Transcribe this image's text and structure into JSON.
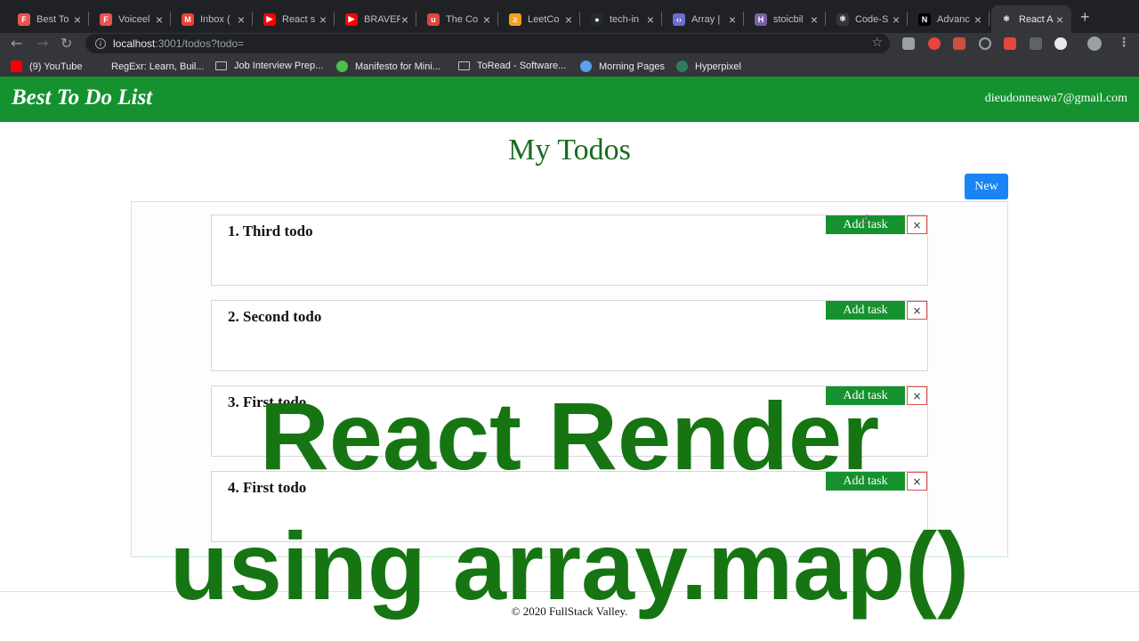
{
  "browser": {
    "tabs": [
      {
        "label": "Best To",
        "color": "#e8554e",
        "glyph": "F"
      },
      {
        "label": "Voiceel",
        "color": "#e8554e",
        "glyph": "F"
      },
      {
        "label": "Inbox (",
        "color": "#ea4335",
        "glyph": "M"
      },
      {
        "label": "React s",
        "color": "#ff0000",
        "glyph": "▶"
      },
      {
        "label": "BRAVEF",
        "color": "#ff0000",
        "glyph": "▶"
      },
      {
        "label": "The Co",
        "color": "#e0443f",
        "glyph": "u"
      },
      {
        "label": "LeetCo",
        "color": "#f89f1b",
        "glyph": "≥"
      },
      {
        "label": "tech-in",
        "color": "#24292e",
        "glyph": "●"
      },
      {
        "label": "Array |",
        "color": "#6e6bd4",
        "glyph": "‹›"
      },
      {
        "label": "stoicbil",
        "color": "#7b5ea7",
        "glyph": "H"
      },
      {
        "label": "Code-S",
        "color": "#35363a",
        "glyph": "⚛"
      },
      {
        "label": "Advanc",
        "color": "#000000",
        "glyph": "N"
      },
      {
        "label": "React A",
        "color": "#35363a",
        "glyph": "⚛",
        "active": true
      }
    ],
    "new_tab": "+",
    "url_host": "localhost",
    "url_rest": ":3001/todos?todo=",
    "bookmarks": [
      {
        "label": "(9) YouTube",
        "icon": "youtube-icon"
      },
      {
        "label": "RegExr: Learn, Buil...",
        "icon": "regexr-icon"
      },
      {
        "label": "Job Interview Prep...",
        "icon": "folder-icon"
      },
      {
        "label": "Manifesto for Mini...",
        "icon": "circle-icon"
      },
      {
        "label": "ToRead - Software...",
        "icon": "folder-icon"
      },
      {
        "label": "Morning Pages",
        "icon": "globe-icon"
      },
      {
        "label": "Hyperpixel",
        "icon": "h-icon"
      }
    ]
  },
  "app": {
    "brand": "Best To Do List",
    "user_email": "dieudonneawa7@gmail.com",
    "page_title": "My Todos",
    "new_button": "New",
    "add_task_label": "Add task",
    "delete_label": "×",
    "todos": [
      {
        "title": "1. Third todo"
      },
      {
        "title": "2. Second todo"
      },
      {
        "title": "3. First todo"
      },
      {
        "title": "4. First todo"
      }
    ],
    "footer": "© 2020 FullStack Valley."
  },
  "overlay": {
    "line1": "React Render",
    "line2": "using array.map()"
  },
  "colors": {
    "header_green": "#15922f",
    "title_green": "#196b1f",
    "new_button_blue": "#1a84f4",
    "overlay_green": "#167512",
    "delete_border": "#d9534f"
  }
}
